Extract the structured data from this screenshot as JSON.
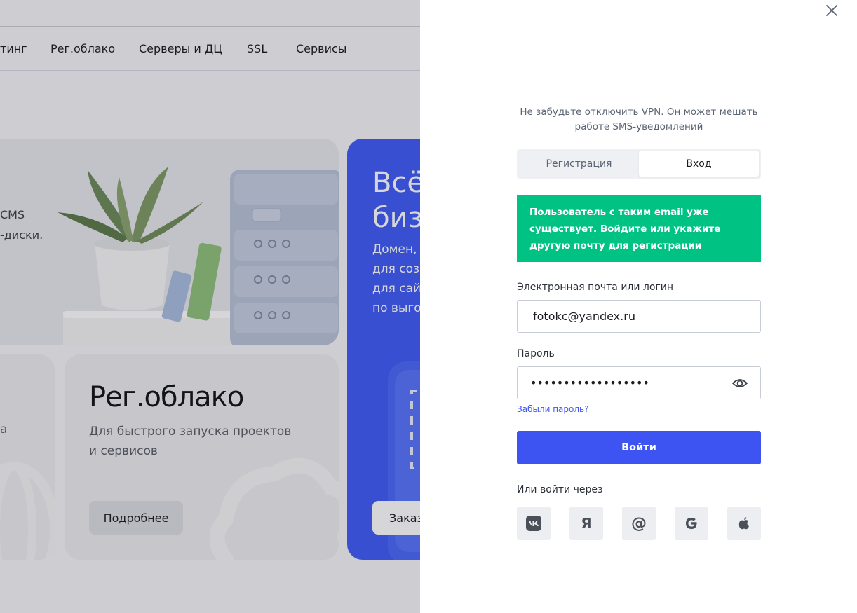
{
  "background": {
    "nav": [
      "тинг",
      "Рег.облако",
      "Серверы и ДЦ",
      "SSL",
      "Сервисы"
    ],
    "hero_lines": [
      "CMS",
      "-диски."
    ],
    "left_card_fragment": "а",
    "cloud_card": {
      "title": "Рег.облако",
      "subtitle_line1": "Для быстрого запуска проектов",
      "subtitle_line2": "и сервисов",
      "button": "Подробнее"
    },
    "blue_card": {
      "title_line1": "Всё",
      "title_line2": "биз",
      "lines": [
        "Домен,",
        "для соз",
        "для сайт",
        "по выгод"
      ],
      "button": "Заказ"
    }
  },
  "panel": {
    "vpn_note": "Не забудьте отключить VPN. Он может мешать работе SMS-уведомлений",
    "tabs": [
      {
        "label": "Регистрация",
        "active": false
      },
      {
        "label": "Вход",
        "active": true
      }
    ],
    "alert": "Пользователь с таким email уже существует. Войдите или укажите другую почту для регистрации",
    "alert_color": "#00c283",
    "email_label": "Электронная почта или логин",
    "email_value": "fotokc@yandex.ru",
    "password_label": "Пароль",
    "password_value": "••••••••••••••••••",
    "forgot": "Забыли пароль?",
    "login_button": "Войти",
    "accent_color": "#3d54f3",
    "or_label": "Или войти через",
    "socials": [
      "vk-icon",
      "yandex-icon",
      "mail-at-icon",
      "google-icon",
      "apple-icon"
    ],
    "yandex_glyph": "Я",
    "mail_glyph": "@"
  }
}
